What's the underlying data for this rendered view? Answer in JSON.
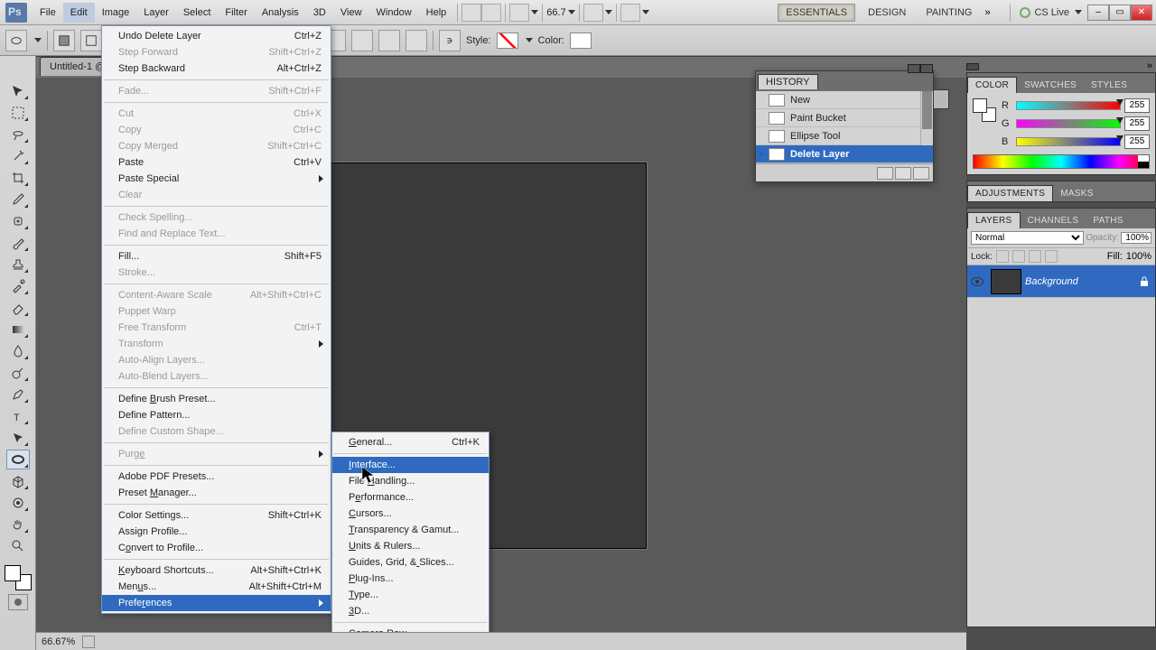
{
  "menubar": {
    "items": [
      "File",
      "Edit",
      "Image",
      "Layer",
      "Select",
      "Filter",
      "Analysis",
      "3D",
      "View",
      "Window",
      "Help"
    ],
    "open_index": 1,
    "zoom": "66.7",
    "workspaces": [
      "ESSENTIALS",
      "DESIGN",
      "PAINTING"
    ],
    "workspace_active": 0,
    "cs_live": "CS Live"
  },
  "options": {
    "style_label": "Style:",
    "color_label": "Color:"
  },
  "doctab": {
    "label": "Untitled-1 @"
  },
  "edit_menu": [
    {
      "label": "Undo Delete Layer",
      "sc": "Ctrl+Z"
    },
    {
      "label": "Step Forward",
      "sc": "Shift+Ctrl+Z",
      "dis": true
    },
    {
      "label": "Step Backward",
      "sc": "Alt+Ctrl+Z"
    },
    {
      "sep": true
    },
    {
      "label": "Fade...",
      "sc": "Shift+Ctrl+F",
      "dis": true
    },
    {
      "sep": true
    },
    {
      "label": "Cut",
      "sc": "Ctrl+X",
      "dis": true
    },
    {
      "label": "Copy",
      "sc": "Ctrl+C",
      "dis": true
    },
    {
      "label": "Copy Merged",
      "sc": "Shift+Ctrl+C",
      "dis": true
    },
    {
      "label": "Paste",
      "sc": "Ctrl+V"
    },
    {
      "label": "Paste Special",
      "sub": true
    },
    {
      "label": "Clear",
      "dis": true
    },
    {
      "sep": true
    },
    {
      "label": "Check Spelling...",
      "dis": true
    },
    {
      "label": "Find and Replace Text...",
      "dis": true
    },
    {
      "sep": true
    },
    {
      "label": "Fill...",
      "sc": "Shift+F5"
    },
    {
      "label": "Stroke...",
      "dis": true
    },
    {
      "sep": true
    },
    {
      "label": "Content-Aware Scale",
      "sc": "Alt+Shift+Ctrl+C",
      "dis": true
    },
    {
      "label": "Puppet Warp",
      "dis": true
    },
    {
      "label": "Free Transform",
      "sc": "Ctrl+T",
      "dis": true
    },
    {
      "label": "Transform",
      "sub": true,
      "dis": true
    },
    {
      "label": "Auto-Align Layers...",
      "dis": true
    },
    {
      "label": "Auto-Blend Layers...",
      "dis": true
    },
    {
      "sep": true
    },
    {
      "label": "Define Brush Preset...",
      "u": 7
    },
    {
      "label": "Define Pattern..."
    },
    {
      "label": "Define Custom Shape...",
      "dis": true
    },
    {
      "sep": true
    },
    {
      "label": "Purge",
      "sub": true,
      "dis": true,
      "u": 4
    },
    {
      "sep": true
    },
    {
      "label": "Adobe PDF Presets..."
    },
    {
      "label": "Preset Manager...",
      "u": 7
    },
    {
      "sep": true
    },
    {
      "label": "Color Settings...",
      "sc": "Shift+Ctrl+K"
    },
    {
      "label": "Assign Profile..."
    },
    {
      "label": "Convert to Profile...",
      "u": 1
    },
    {
      "sep": true
    },
    {
      "label": "Keyboard Shortcuts...",
      "sc": "Alt+Shift+Ctrl+K",
      "u": 0
    },
    {
      "label": "Menus...",
      "sc": "Alt+Shift+Ctrl+M",
      "u": 3
    },
    {
      "label": "Preferences",
      "sub": true,
      "hl": true,
      "u": 5
    }
  ],
  "pref_menu": [
    {
      "label": "General...",
      "sc": "Ctrl+K",
      "u": 0
    },
    {
      "sep": true
    },
    {
      "label": "Interface...",
      "hl": true,
      "u": 0
    },
    {
      "label": "File Handling...",
      "u": 5
    },
    {
      "label": "Performance...",
      "u": 1
    },
    {
      "label": "Cursors...",
      "u": 0
    },
    {
      "label": "Transparency & Gamut...",
      "u": 0
    },
    {
      "label": "Units & Rulers...",
      "u": 0
    },
    {
      "label": "Guides, Grid, & Slices...",
      "u": 15
    },
    {
      "label": "Plug-Ins...",
      "u": 0
    },
    {
      "label": "Type...",
      "u": 0
    },
    {
      "label": "3D...",
      "u": 0
    },
    {
      "sep": true
    },
    {
      "label": "Camera Raw..."
    }
  ],
  "history": {
    "tab": "HISTORY",
    "rows": [
      {
        "label": "New"
      },
      {
        "label": "Paint Bucket"
      },
      {
        "label": "Ellipse Tool"
      },
      {
        "label": "Delete Layer",
        "sel": true
      }
    ]
  },
  "color_panel": {
    "tabs": [
      "COLOR",
      "SWATCHES",
      "STYLES"
    ],
    "active": 0,
    "r": {
      "label": "R",
      "val": "255"
    },
    "g": {
      "label": "G",
      "val": "255"
    },
    "b": {
      "label": "B",
      "val": "255"
    }
  },
  "adjustments": {
    "tabs": [
      "ADJUSTMENTS",
      "MASKS"
    ],
    "active": 0
  },
  "layers": {
    "tabs": [
      "LAYERS",
      "CHANNELS",
      "PATHS"
    ],
    "active": 0,
    "blend": "Normal",
    "opacity_label": "Opacity:",
    "opacity": "100%",
    "lock_label": "Lock:",
    "fill_label": "Fill:",
    "fill": "100%",
    "rows": [
      {
        "name": "Background",
        "locked": true,
        "sel": true
      }
    ]
  },
  "status": {
    "zoom": "66.67%"
  },
  "tools": [
    "move",
    "marquee",
    "lasso",
    "wand",
    "crop",
    "eyedropper",
    "heal",
    "brush",
    "stamp",
    "history-brush",
    "eraser",
    "gradient",
    "blur",
    "dodge",
    "pen",
    "type",
    "path-select",
    "ellipse",
    "3d",
    "3d-cam",
    "hand",
    "zoom"
  ]
}
